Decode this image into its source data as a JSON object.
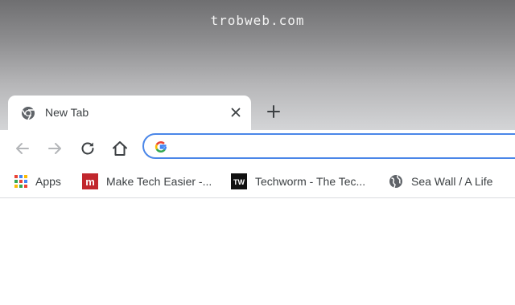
{
  "watermark": "trobweb.com",
  "tab": {
    "title": "New Tab"
  },
  "toolbar": {
    "search_value": ""
  },
  "bookmarks": [
    {
      "label": "Apps",
      "icon": "apps-grid-icon"
    },
    {
      "label": "Make Tech Easier -...",
      "icon": "maketecheasier-logo-icon"
    },
    {
      "label": "Techworm - The Tec...",
      "icon": "techworm-logo-icon"
    },
    {
      "label": "Sea Wall / A Life",
      "icon": "globe-icon"
    }
  ],
  "colors": {
    "accent": "#4a86e8",
    "toolbar_icon": "#5f6368",
    "maketecheasier_red": "#c1272d",
    "techworm_black": "#111111"
  }
}
